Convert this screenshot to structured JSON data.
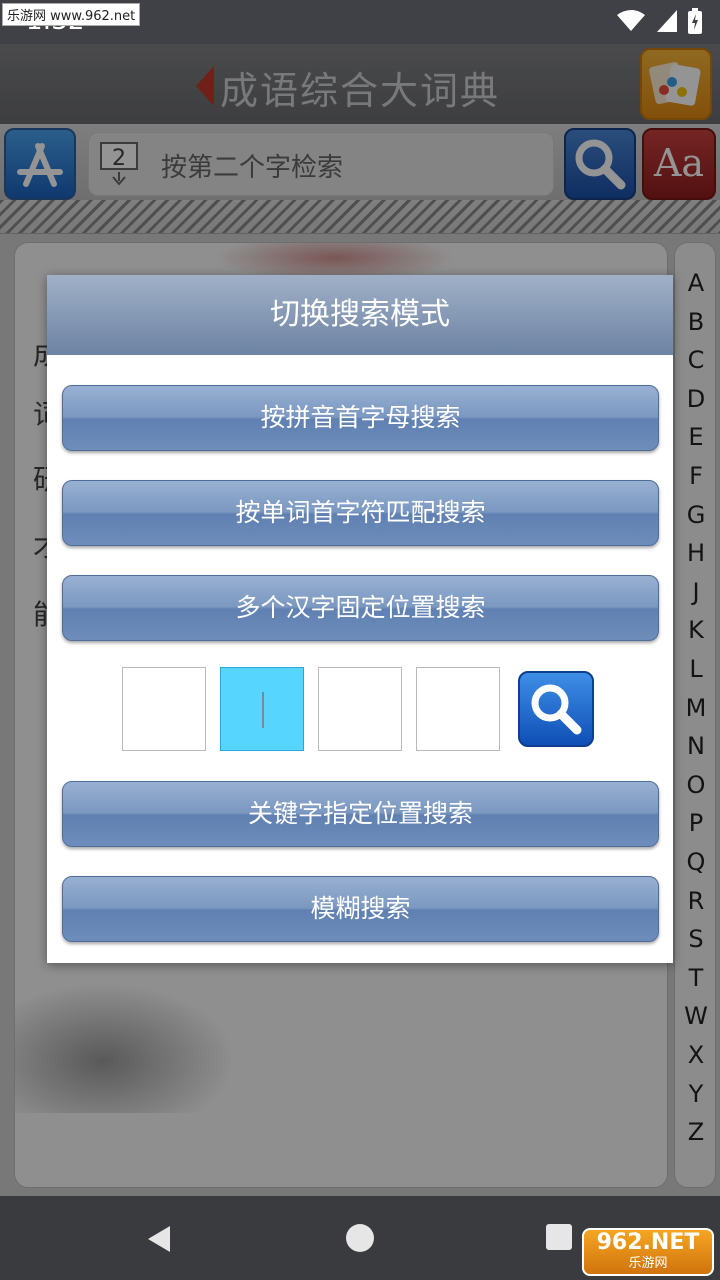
{
  "status_bar": {
    "time": "1:32",
    "watermark": "乐游网 www.962.net"
  },
  "app_title": "成语综合大词典",
  "search": {
    "placeholder": "按第二个字检索",
    "mode_digit": "2"
  },
  "font_button_label": "Aa",
  "background_text": [
    "成",
    "词",
    "研",
    "才",
    "能"
  ],
  "alphabet_index": [
    "A",
    "B",
    "C",
    "D",
    "E",
    "F",
    "G",
    "H",
    "J",
    "K",
    "L",
    "M",
    "N",
    "O",
    "P",
    "Q",
    "R",
    "S",
    "T",
    "W",
    "X",
    "Y",
    "Z"
  ],
  "dialog": {
    "title": "切换搜索模式",
    "options": [
      "按拼音首字母搜索",
      "按单词首字符匹配搜索",
      "多个汉字固定位置搜索",
      "关键字指定位置搜索",
      "模糊搜索"
    ],
    "active_char_box": 2
  },
  "watermark_corner": {
    "brand": "962.NET",
    "sub": "乐游网"
  },
  "colors": {
    "dialog_button": "#6e8dbb",
    "active_box": "#55d5ff",
    "title_bar": "#7f8083"
  }
}
